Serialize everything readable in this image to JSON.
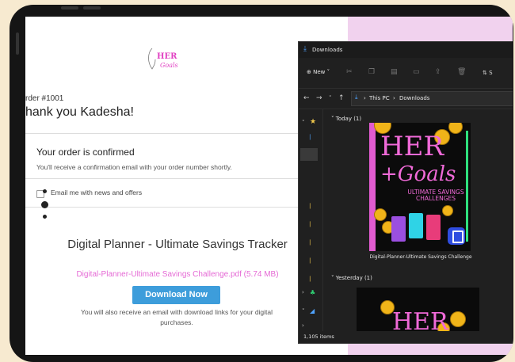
{
  "checkout": {
    "brand_logo": "HER Goals",
    "order_number": "rder #1001",
    "thank_you": "hank you Kadesha!",
    "confirmed_heading": "Your order is confirmed",
    "confirmed_message": "You'll receive a confirmation email with your order number shortly.",
    "email_optin_label": "Email me with news and offers",
    "product_title": "Digital Planner - Ultimate Savings Tracker",
    "file_link": "Digital-Planner-Ultimate Savings Challenge.pdf (5.74 MB)",
    "download_button": "Download Now",
    "download_note": "You will also receive an email with download links for your digital purchases."
  },
  "explorer": {
    "window_title": "Downloads",
    "toolbar_new": "New",
    "toolbar_sort": "S",
    "breadcrumb": [
      "This PC",
      "Downloads"
    ],
    "groups": [
      {
        "label": "Today (1)"
      },
      {
        "label": "Yesterday (1)"
      }
    ],
    "files": [
      {
        "name": "Digital-Planner-Ultimate Savings Challenge",
        "thumb_title": "HER",
        "thumb_script": "+Goals",
        "thumb_subtitle": "ULTIMATE SAVINGS CHALLENGES"
      },
      {
        "thumb_title": "HER"
      }
    ],
    "status_items": "1,105 items"
  },
  "colors": {
    "accent_pink": "#e56ad5",
    "download_blue": "#3d9ddb",
    "explorer_bg": "#202020"
  }
}
